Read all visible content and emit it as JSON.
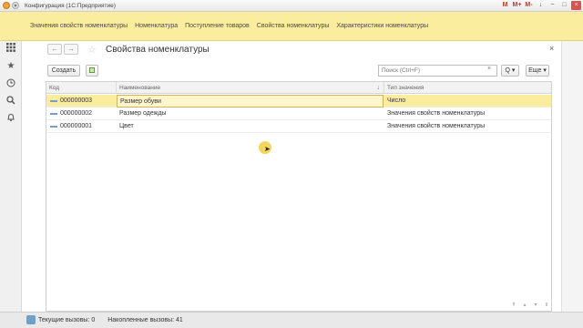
{
  "window": {
    "title": "Конфигурация  (1С:Предприятие)",
    "controls": [
      "M",
      "M+",
      "M-",
      "↓",
      "−",
      "□",
      "×"
    ]
  },
  "sections": [
    "Значения свойств номенклатуры",
    "Номенклатура",
    "Поступление товаров",
    "Свойства номенклатуры",
    "Характеристики номенклатуры"
  ],
  "left_panel_icons": [
    "grid-icon",
    "star-icon",
    "history-icon",
    "search-icon",
    "bell-icon"
  ],
  "form": {
    "title": "Свойства номенклатуры",
    "back": "←",
    "forward": "→",
    "close": "×",
    "favorite": "☆"
  },
  "toolbar": {
    "create_label": "Создать",
    "search_placeholder": "Поиск (Ctrl+F)",
    "search_clear": "×",
    "search_btn": "Q ▾",
    "more_label": "Еще ▾"
  },
  "table": {
    "columns": [
      "Код",
      "Наименование",
      "Тип значения"
    ],
    "sort_indicator": "↓",
    "rows": [
      {
        "code": "000000003",
        "name": "Размер обуви",
        "type": "Число"
      },
      {
        "code": "000000002",
        "name": "Размер одежды",
        "type": "Значения свойств номенклатуры"
      },
      {
        "code": "000000001",
        "name": "Цвет",
        "type": "Значения свойств номенклатуры"
      }
    ],
    "selected_row": 0
  },
  "status": {
    "current_calls": "Текущие вызовы: 0",
    "accumulated_calls": "Накопленные вызовы: 41"
  },
  "colors": {
    "accent_yellow": "#fbed9e",
    "titlebar_orange": "#f3a33a"
  }
}
